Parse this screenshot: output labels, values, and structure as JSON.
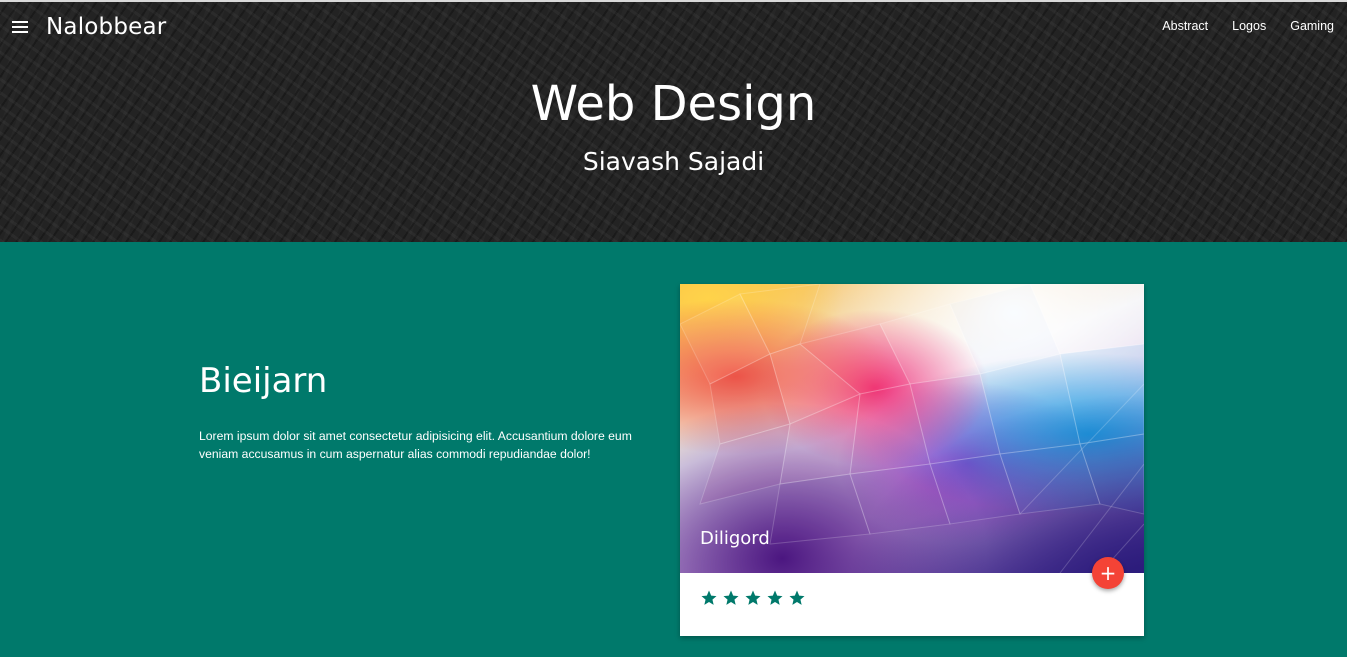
{
  "navbar": {
    "brand": "Nalobbear",
    "links": [
      "Abstract",
      "Logos",
      "Gaming"
    ]
  },
  "hero": {
    "title": "Web Design",
    "subtitle": "Siavash Sajadi"
  },
  "content": {
    "title": "Bieijarn",
    "text": "Lorem ipsum dolor sit amet consectetur adipisicing elit. Accusantium dolore eum veniam accusamus in cum aspernatur alias commodi repudiandae dolor!"
  },
  "card": {
    "caption": "Diligord",
    "fab_symbol": "+",
    "rating": 5,
    "rating_max": 5
  },
  "colors": {
    "teal_background": "#00796b",
    "hero_background": "#232323",
    "fab_red": "#f44336",
    "star_color": "#00796b"
  },
  "icons": {
    "menu": "hamburger-menu-icon",
    "fab": "plus-icon",
    "rating": "star-icon"
  }
}
